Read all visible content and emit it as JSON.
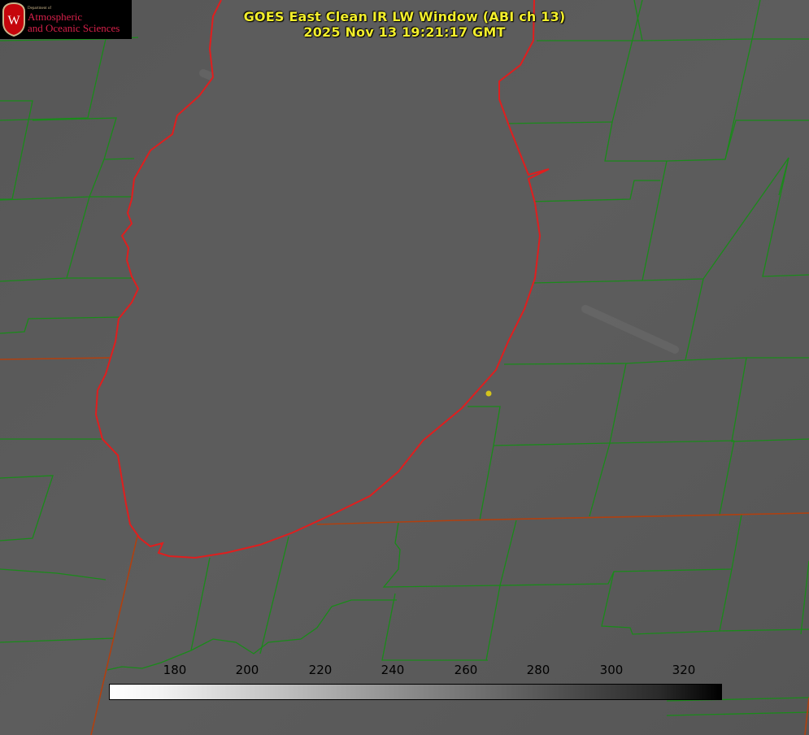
{
  "header": {
    "title": "GOES East Clean IR LW Window (ABI ch 13)",
    "timestamp": "2025 Nov 13 19:21:17 GMT"
  },
  "logo": {
    "department": "Department of",
    "line1": "Atmospheric",
    "line2": "and Oceanic Sciences",
    "emblem_letter": "W",
    "colors": {
      "background": "#000000",
      "text": "#d6204a",
      "shield": "#c5050c"
    }
  },
  "colorbar": {
    "ticks": [
      "180",
      "200",
      "220",
      "240",
      "260",
      "280",
      "300",
      "320"
    ],
    "gradient": "white-to-black"
  },
  "map_colors": {
    "county_lines": "#1a8a1a",
    "state_lines": "#b04010",
    "lake_shoreline": "#e01e1e",
    "marker": "#d4c41c",
    "background_gray": "#5a5a5a"
  }
}
